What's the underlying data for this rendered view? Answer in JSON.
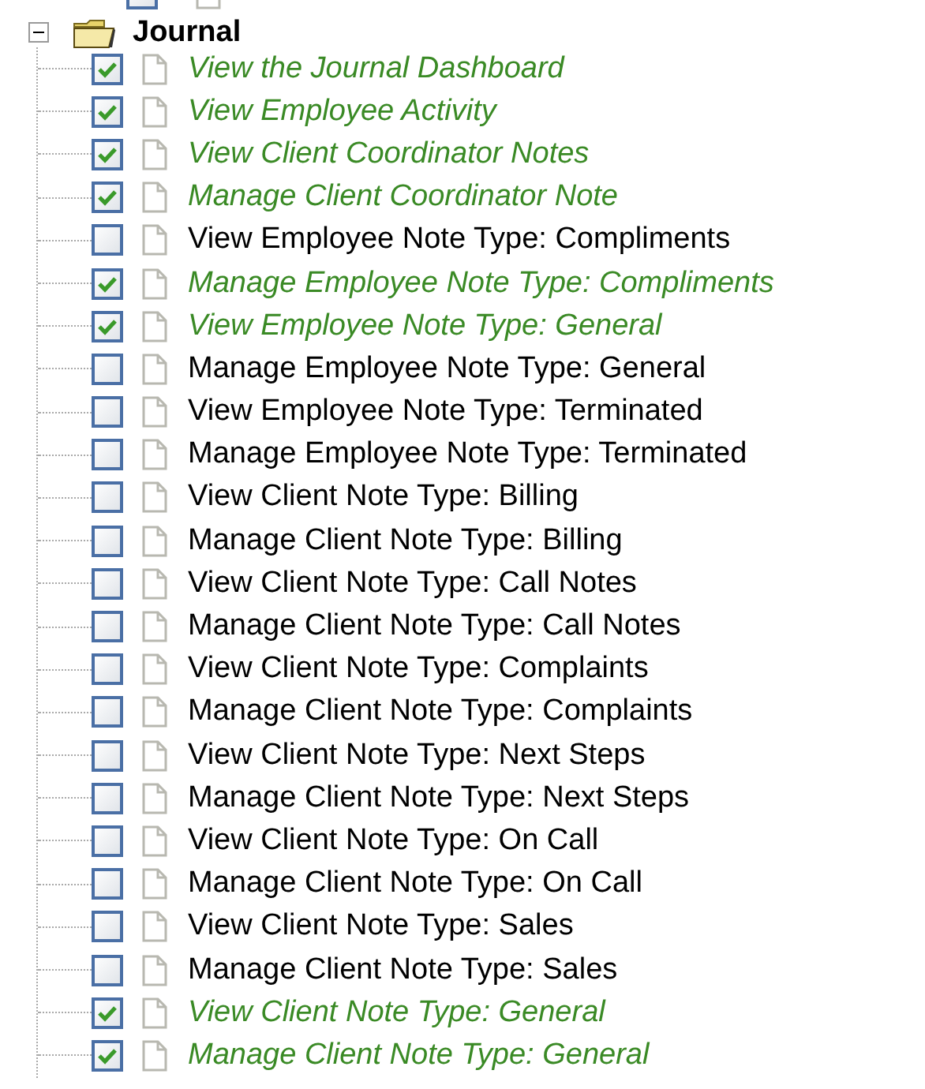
{
  "cut_item": {
    "checked": false
  },
  "folder": {
    "label": "Journal",
    "expanded": true,
    "items": [
      {
        "label": "View the Journal Dashboard",
        "checked": true
      },
      {
        "label": "View Employee Activity",
        "checked": true
      },
      {
        "label": "View Client Coordinator Notes",
        "checked": true
      },
      {
        "label": "Manage Client Coordinator Note",
        "checked": true
      },
      {
        "label": "View Employee Note Type: Compliments",
        "checked": false
      },
      {
        "label": "Manage Employee Note Type: Compliments",
        "checked": true
      },
      {
        "label": "View Employee Note Type: General",
        "checked": true
      },
      {
        "label": "Manage Employee Note Type: General",
        "checked": false
      },
      {
        "label": "View Employee Note Type: Terminated",
        "checked": false
      },
      {
        "label": "Manage Employee Note Type: Terminated",
        "checked": false
      },
      {
        "label": "View Client Note Type: Billing",
        "checked": false
      },
      {
        "label": "Manage Client Note Type: Billing",
        "checked": false
      },
      {
        "label": "View Client Note Type: Call Notes",
        "checked": false
      },
      {
        "label": "Manage Client Note Type: Call Notes",
        "checked": false
      },
      {
        "label": "View Client Note Type: Complaints",
        "checked": false
      },
      {
        "label": "Manage Client Note Type: Complaints",
        "checked": false
      },
      {
        "label": "View Client Note Type: Next Steps",
        "checked": false
      },
      {
        "label": "Manage Client Note Type: Next Steps",
        "checked": false
      },
      {
        "label": "View Client Note Type: On Call",
        "checked": false
      },
      {
        "label": "Manage Client Note Type: On Call",
        "checked": false
      },
      {
        "label": "View Client Note Type: Sales",
        "checked": false
      },
      {
        "label": "Manage Client Note Type: Sales",
        "checked": false
      },
      {
        "label": "View Client Note Type: General",
        "checked": true
      },
      {
        "label": "Manage Client Note Type: General",
        "checked": true
      }
    ]
  }
}
